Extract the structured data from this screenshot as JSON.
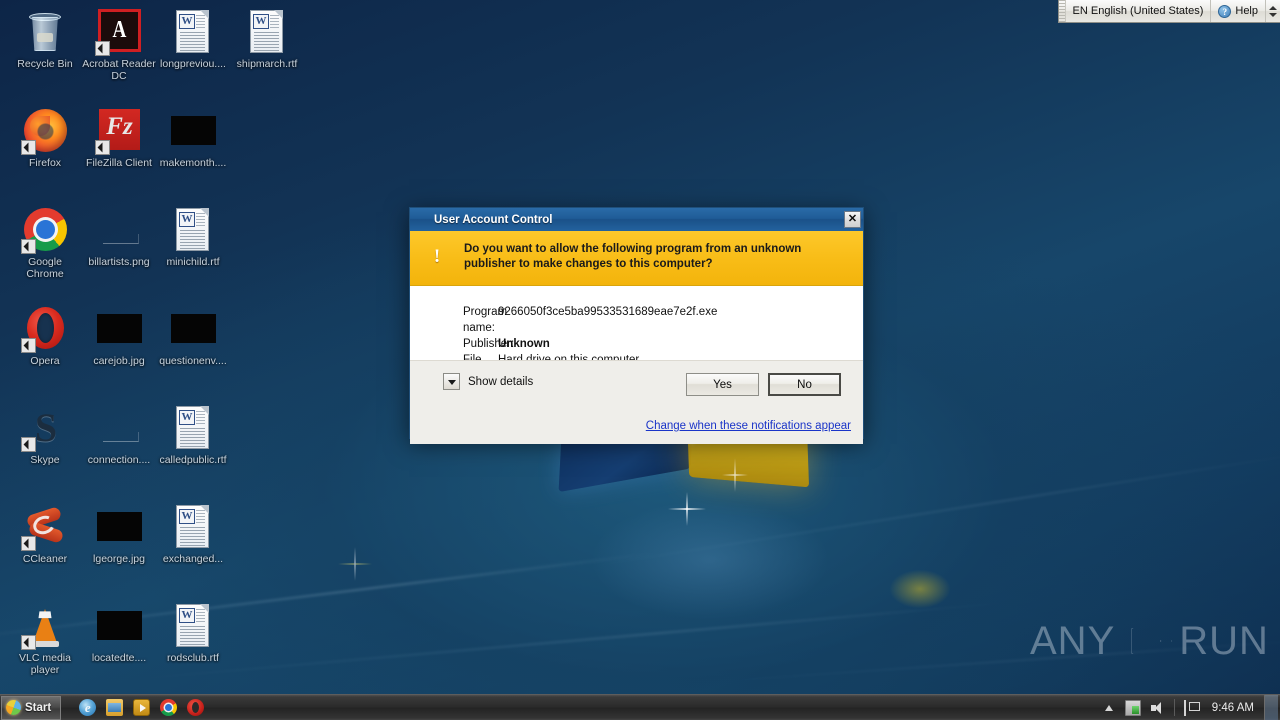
{
  "desktop": {
    "icons": [
      {
        "label": "Recycle Bin",
        "kind": "recycle-bin",
        "col": 0,
        "row": 0
      },
      {
        "label": "Acrobat Reader DC",
        "kind": "acrobat",
        "col": 1,
        "row": 0
      },
      {
        "label": "longpreviou....",
        "kind": "word-doc",
        "col": 2,
        "row": 0
      },
      {
        "label": "shipmarch.rtf",
        "kind": "word-doc",
        "col": 3,
        "row": 0
      },
      {
        "label": "Firefox",
        "kind": "firefox",
        "col": 0,
        "row": 1
      },
      {
        "label": "FileZilla Client",
        "kind": "filezilla",
        "col": 1,
        "row": 1
      },
      {
        "label": "makemonth....",
        "kind": "black-thumb",
        "col": 2,
        "row": 1
      },
      {
        "label": "Google Chrome",
        "kind": "chrome",
        "col": 0,
        "row": 2
      },
      {
        "label": "billartists.png",
        "kind": "faint-thumb",
        "col": 1,
        "row": 2
      },
      {
        "label": "minichild.rtf",
        "kind": "word-doc",
        "col": 2,
        "row": 2
      },
      {
        "label": "Opera",
        "kind": "opera",
        "col": 0,
        "row": 3
      },
      {
        "label": "carejob.jpg",
        "kind": "black-thumb",
        "col": 1,
        "row": 3
      },
      {
        "label": "questionenv....",
        "kind": "black-thumb",
        "col": 2,
        "row": 3
      },
      {
        "label": "Skype",
        "kind": "skype",
        "col": 0,
        "row": 4
      },
      {
        "label": "connection....",
        "kind": "faint-thumb",
        "col": 1,
        "row": 4
      },
      {
        "label": "calledpublic.rtf",
        "kind": "word-doc",
        "col": 2,
        "row": 4
      },
      {
        "label": "CCleaner",
        "kind": "ccleaner",
        "col": 0,
        "row": 5
      },
      {
        "label": "lgeorge.jpg",
        "kind": "black-thumb",
        "col": 1,
        "row": 5
      },
      {
        "label": "exchanged...",
        "kind": "word-doc",
        "col": 2,
        "row": 5
      },
      {
        "label": "VLC media player",
        "kind": "vlc",
        "col": 0,
        "row": 6
      },
      {
        "label": "locatedte....",
        "kind": "black-thumb",
        "col": 1,
        "row": 6
      },
      {
        "label": "rodsclub.rtf",
        "kind": "word-doc",
        "col": 2,
        "row": 6
      }
    ]
  },
  "language_bar": {
    "language_label": "EN English (United States)",
    "help_label": "Help",
    "help_icon": "question-circle-icon",
    "spinner_icon": "updown-arrows-icon"
  },
  "uac_dialog": {
    "title": "User Account Control",
    "title_icon": "uac-shield-icon",
    "close_label": "✕",
    "banner_icon": "warning-shield-icon",
    "banner_text": "Do you want to allow the following program from an unknown publisher to make changes to this computer?",
    "fields": [
      {
        "key": "Program name:",
        "value": "9266050f3ce5ba99533531689eae7e2f.exe",
        "bold": false
      },
      {
        "key": "Publisher:",
        "value": "Unknown",
        "bold": true
      },
      {
        "key": "File origin:",
        "value": "Hard drive on this computer",
        "bold": false
      }
    ],
    "show_details_label": "Show details",
    "show_details_icon": "chevron-down-icon",
    "yes_label": "Yes",
    "no_label": "No",
    "change_notifications_link": "Change when these notifications appear",
    "colors": {
      "titlebar": "#1f5c97",
      "banner": "#f8bc16",
      "link": "#1a34c8",
      "body": "#ffffff",
      "footer": "#efeeea"
    }
  },
  "watermark": {
    "left_text": "ANY",
    "right_text": "RUN",
    "logo_icon": "play-triangle-icon"
  },
  "taskbar": {
    "start_label": "Start",
    "start_icon": "windows-orb-icon",
    "quick_launch": [
      {
        "name": "internet-explorer-icon"
      },
      {
        "name": "windows-explorer-icon"
      },
      {
        "name": "windows-media-player-icon"
      },
      {
        "name": "google-chrome-icon"
      },
      {
        "name": "opera-icon"
      }
    ],
    "tray": [
      {
        "name": "show-hidden-icons-arrow-icon"
      },
      {
        "name": "network-icon"
      },
      {
        "name": "volume-icon"
      },
      {
        "name": "action-center-flag-icon"
      }
    ],
    "clock": "9:46 AM",
    "show_desktop_label": ""
  }
}
